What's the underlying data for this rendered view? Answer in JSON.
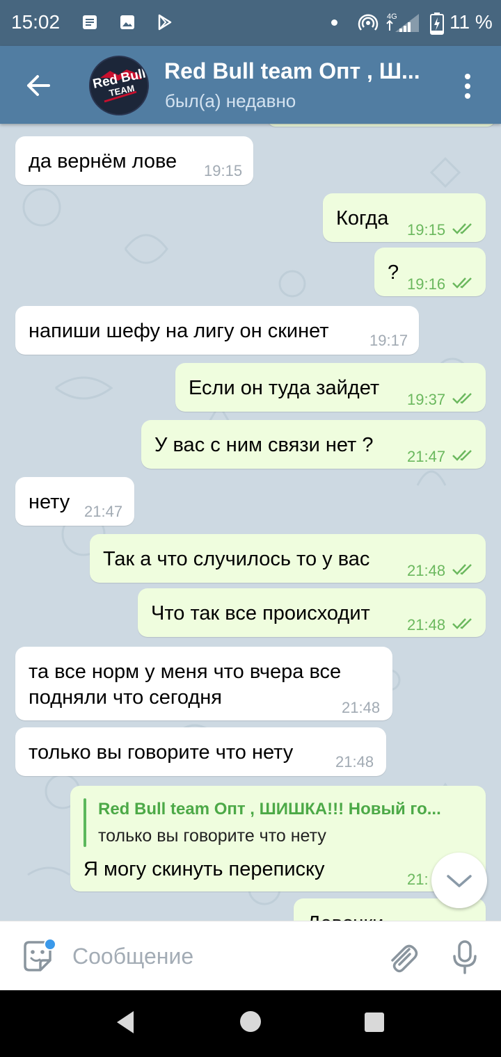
{
  "status_bar": {
    "time": "15:02",
    "battery": "11 %",
    "icons": [
      "notification-icon",
      "gallery-icon",
      "play-store-icon",
      "hotspot-icon",
      "4g-signal-icon",
      "battery-charging-icon"
    ]
  },
  "header": {
    "title": "Red Bull team Опт , Ш...",
    "status": "был(а) недавно",
    "avatar_line1": "Red Bull",
    "avatar_line2": "TEAM",
    "colors": {
      "bar": "#517da2",
      "status_bar": "#47667f"
    }
  },
  "messages": [
    {
      "dir": "in",
      "text": "да вернём лове",
      "time": "19:15"
    },
    {
      "dir": "out",
      "text": "Когда",
      "time": "19:15"
    },
    {
      "dir": "out",
      "text": "?",
      "time": "19:16"
    },
    {
      "dir": "in",
      "text": "напиши шефу на лигу он скинет",
      "time": "19:17"
    },
    {
      "dir": "out",
      "text": "Если он туда зайдет",
      "time": "19:37"
    },
    {
      "dir": "out",
      "text": "У вас с ним связи нет ?",
      "time": "21:47"
    },
    {
      "dir": "in",
      "text": "нету",
      "time": "21:47"
    },
    {
      "dir": "out",
      "text": "Так а что случилось то у вас",
      "time": "21:48"
    },
    {
      "dir": "out",
      "text": "Что так все происходит",
      "time": "21:48"
    },
    {
      "dir": "in",
      "text_line1": "та все норм у меня что вчера все",
      "text_line2": "подняли что сегодня",
      "time": "21:48"
    },
    {
      "dir": "in",
      "text": "только вы говорите что нету",
      "time": "21:48"
    },
    {
      "dir": "out",
      "reply_author": "Red Bull team Опт , ШИШКА!!! Новый го...",
      "reply_text": "только вы говорите что нету",
      "text": "Я могу скинуть переписку",
      "time": "21:"
    },
    {
      "dir": "out",
      "text": "Девочки",
      "time": ""
    }
  ],
  "input": {
    "placeholder": "Сообщение"
  },
  "colors": {
    "incoming": "#ffffff",
    "outgoing": "#effdde",
    "time_out": "#6bb85e",
    "chat_bg": "#cdd9e2"
  }
}
